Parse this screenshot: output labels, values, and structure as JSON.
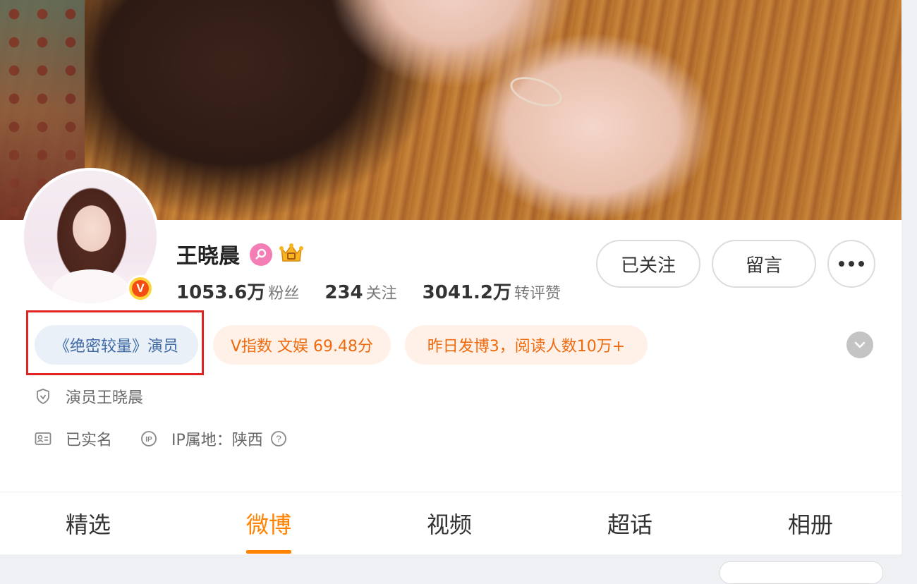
{
  "profile": {
    "name": "王晓晨",
    "badge_letter": "V",
    "stats": [
      {
        "value": "1053.6万",
        "label": "粉丝"
      },
      {
        "value": "234",
        "label": "关注"
      },
      {
        "value": "3041.2万",
        "label": "转评赞"
      }
    ]
  },
  "actions": {
    "follow_label": "已关注",
    "message_label": "留言"
  },
  "tags": {
    "role": "《绝密较量》演员",
    "vindex": "V指数 文娱 69.48分",
    "post_stats": "昨日发博3，阅读人数10万+"
  },
  "info": {
    "verification": "演员王晓晨",
    "real_name": "已实名",
    "ip_label": "IP属地：陕西"
  },
  "tabs": [
    {
      "label": "精选"
    },
    {
      "label": "微博",
      "active": true
    },
    {
      "label": "视频"
    },
    {
      "label": "超话"
    },
    {
      "label": "相册"
    }
  ],
  "colors": {
    "accent": "#ff8200",
    "tag_blue_text": "#3e6aa6",
    "tag_orange_text": "#ef6a0e",
    "highlight_border": "#e02424"
  }
}
